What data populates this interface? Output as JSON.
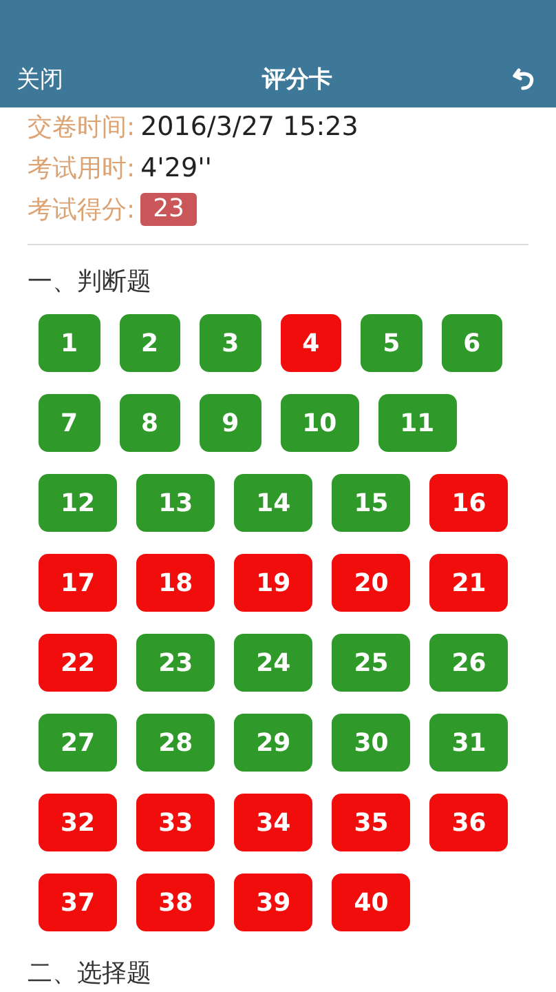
{
  "header": {
    "close": "关闭",
    "title": "评分卡"
  },
  "info": [
    {
      "label": "交卷时间:",
      "value": "2016/3/27 15:23",
      "kind": "text"
    },
    {
      "label": "考试用时:",
      "value": "4'29''",
      "kind": "text"
    },
    {
      "label": "考试得分:",
      "value": "23",
      "kind": "score"
    }
  ],
  "sections": [
    {
      "title": "一、判断题",
      "questions": [
        {
          "number": "1",
          "correct": true
        },
        {
          "number": "2",
          "correct": true
        },
        {
          "number": "3",
          "correct": true
        },
        {
          "number": "4",
          "correct": false
        },
        {
          "number": "5",
          "correct": true
        },
        {
          "number": "6",
          "correct": true
        },
        {
          "number": "7",
          "correct": true
        },
        {
          "number": "8",
          "correct": true
        },
        {
          "number": "9",
          "correct": true
        },
        {
          "number": "10",
          "correct": true
        },
        {
          "number": "11",
          "correct": true
        },
        {
          "number": "12",
          "correct": true
        },
        {
          "number": "13",
          "correct": true
        },
        {
          "number": "14",
          "correct": true
        },
        {
          "number": "15",
          "correct": true
        },
        {
          "number": "16",
          "correct": false
        },
        {
          "number": "17",
          "correct": false
        },
        {
          "number": "18",
          "correct": false
        },
        {
          "number": "19",
          "correct": false
        },
        {
          "number": "20",
          "correct": false
        },
        {
          "number": "21",
          "correct": false
        },
        {
          "number": "22",
          "correct": false
        },
        {
          "number": "23",
          "correct": true
        },
        {
          "number": "24",
          "correct": true
        },
        {
          "number": "25",
          "correct": true
        },
        {
          "number": "26",
          "correct": true
        },
        {
          "number": "27",
          "correct": true
        },
        {
          "number": "28",
          "correct": true
        },
        {
          "number": "29",
          "correct": true
        },
        {
          "number": "30",
          "correct": true
        },
        {
          "number": "31",
          "correct": true
        },
        {
          "number": "32",
          "correct": false
        },
        {
          "number": "33",
          "correct": false
        },
        {
          "number": "34",
          "correct": false
        },
        {
          "number": "35",
          "correct": false
        },
        {
          "number": "36",
          "correct": false
        },
        {
          "number": "37",
          "correct": false
        },
        {
          "number": "38",
          "correct": false
        },
        {
          "number": "39",
          "correct": false
        },
        {
          "number": "40",
          "correct": false
        }
      ]
    },
    {
      "title": "二、选择题"
    }
  ]
}
